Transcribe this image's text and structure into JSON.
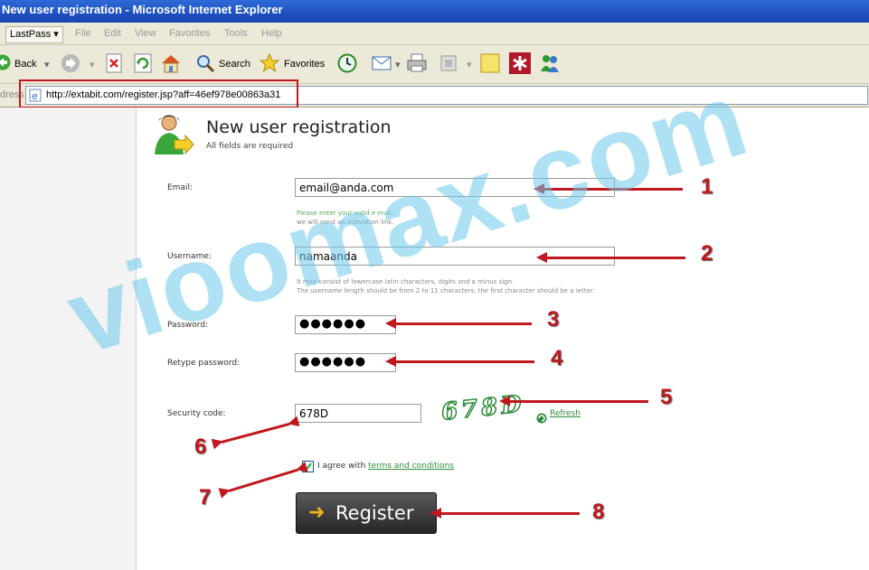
{
  "window": {
    "title": "New user registration - Microsoft Internet Explorer"
  },
  "menubar": {
    "lastpass": "LastPass ▾",
    "items": [
      "File",
      "Edit",
      "View",
      "Favorites",
      "Tools",
      "Help"
    ]
  },
  "toolbar": {
    "back": "Back",
    "search": "Search",
    "favorites": "Favorites"
  },
  "address": {
    "label": "dress",
    "url": "http://extabit.com/register.jsp?aff=46ef978e00863a31"
  },
  "page": {
    "title": "New user registration",
    "subtitle": "All fields are required",
    "email": {
      "label": "Email:",
      "value": "email@anda.com",
      "hint1": "Please enter your valid e-mail,",
      "hint2": "we will send an activation link."
    },
    "username": {
      "label": "Username:",
      "value": "namaanda",
      "hint1": "It may consist of lowercase latin characters, digits and a minus sign.",
      "hint2": "The username length should be from 2 to 11 characters, the first character should be a letter."
    },
    "password": {
      "label": "Password:",
      "value": "●●●●●●"
    },
    "retype": {
      "label": "Retype password:",
      "value": "●●●●●●"
    },
    "security": {
      "label": "Security code:",
      "value": "678D",
      "captcha": "678D",
      "refresh": "Refresh"
    },
    "agree": {
      "text": "I agree with",
      "link": "terms and conditions",
      "checked": true
    },
    "register": "Register"
  },
  "annotations": [
    "1",
    "2",
    "3",
    "4",
    "5",
    "6",
    "7",
    "8"
  ],
  "watermark": "vioomax.com",
  "colors": {
    "annotation": "#c0181e",
    "accent_green": "#2e8b3a",
    "title_blue": "#1e4fbe"
  }
}
